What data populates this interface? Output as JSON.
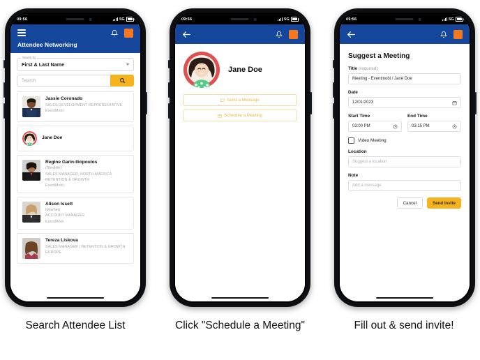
{
  "statusbar": {
    "time": "09:56",
    "network": "5G"
  },
  "phone1": {
    "appbar": {
      "menu_icon": "hamburger-icon",
      "bell_icon": "bell-icon",
      "avatar_icon": "orange-square-avatar"
    },
    "page_title": "Attendee Networking",
    "search": {
      "select_label": "Search by",
      "select_value": "First & Last Name",
      "input_placeholder": "Search",
      "button_icon": "search-icon"
    },
    "attendees": [
      {
        "name": "Jassie Coronado",
        "pronouns": "",
        "role": "SALES DEVELOPMENT REPRESENTATIVE",
        "company": "EventMobi"
      },
      {
        "name": "Jane Doe",
        "pronouns": "",
        "role": "",
        "company": ""
      },
      {
        "name": "Regine Garin-Iliopoulos",
        "pronouns": "(She/Her)",
        "role": "SALES MANAGER, NORTH AMERICA RETENTION & GROWTH",
        "company": "EventMobi"
      },
      {
        "name": "Alison Issett",
        "pronouns": "(she/her)",
        "role": "ACCOUNT MANAGER",
        "company": "EventMobi"
      },
      {
        "name": "Tereza Liskova",
        "pronouns": "",
        "role": "SALES MANAGER | RETENTION & GROWTH EUROPE",
        "company": ""
      }
    ]
  },
  "phone2": {
    "appbar": {
      "back_icon": "back-arrow-icon",
      "bell_icon": "bell-icon",
      "avatar_icon": "orange-square-avatar"
    },
    "profile_name": "Jane Doe",
    "buttons": [
      {
        "label": "Send a Message",
        "icon": "message-icon"
      },
      {
        "label": "Schedule a Meeting",
        "icon": "calendar-icon"
      }
    ]
  },
  "phone3": {
    "appbar": {
      "back_icon": "back-arrow-icon",
      "bell_icon": "bell-icon",
      "avatar_icon": "orange-square-avatar"
    },
    "form_title": "Suggest a Meeting",
    "title_label": "Title",
    "title_required": "(required)",
    "title_value": "Meeting - Eventmobi / Jane Doe",
    "date_label": "Date",
    "date_value": "12/01/2023",
    "date_icon": "calendar-icon",
    "start_label": "Start Time",
    "start_value": "03:00 PM",
    "end_label": "End Time",
    "end_value": "03:15 PM",
    "time_icon": "clock-icon",
    "video_label": "Video Meeting",
    "video_checked": false,
    "location_label": "Location",
    "location_placeholder": "Suggest a location",
    "note_label": "Note",
    "note_placeholder": "Add a message",
    "cancel_label": "Cancel",
    "send_label": "Send Invite"
  },
  "captions": [
    "Search Attendee List",
    "Click \"Schedule a Meeting\"",
    "Fill out & send invite!"
  ],
  "colors": {
    "header_blue": "#14469C",
    "accent_amber": "#F5B41D",
    "avatar_orange": "#F4781F",
    "ghost_border": "#f3dca6"
  }
}
